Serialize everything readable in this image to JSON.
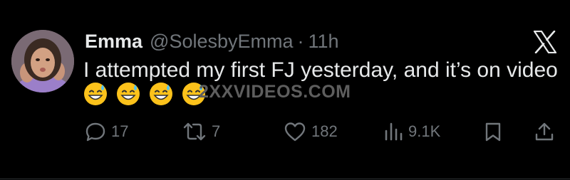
{
  "tweet": {
    "author_name": "Emma",
    "author_handle": "@SolesbyEmma",
    "separator": "·",
    "timestamp": "11h",
    "text": "I attempted my first FJ yesterday, and it’s on video",
    "emojis": [
      "grinning-sweat-emoji",
      "grinning-sweat-emoji",
      "grinning-sweat-emoji",
      "grinning-sweat-emoji"
    ],
    "watermark": "2XXVIDEOS.COM"
  },
  "actions": {
    "replies": "17",
    "reposts": "7",
    "likes": "182",
    "views": "9.1K"
  },
  "colors": {
    "background": "#000000",
    "primary_text": "#e7e9ea",
    "secondary_text": "#71767b",
    "divider": "#2f3336"
  }
}
